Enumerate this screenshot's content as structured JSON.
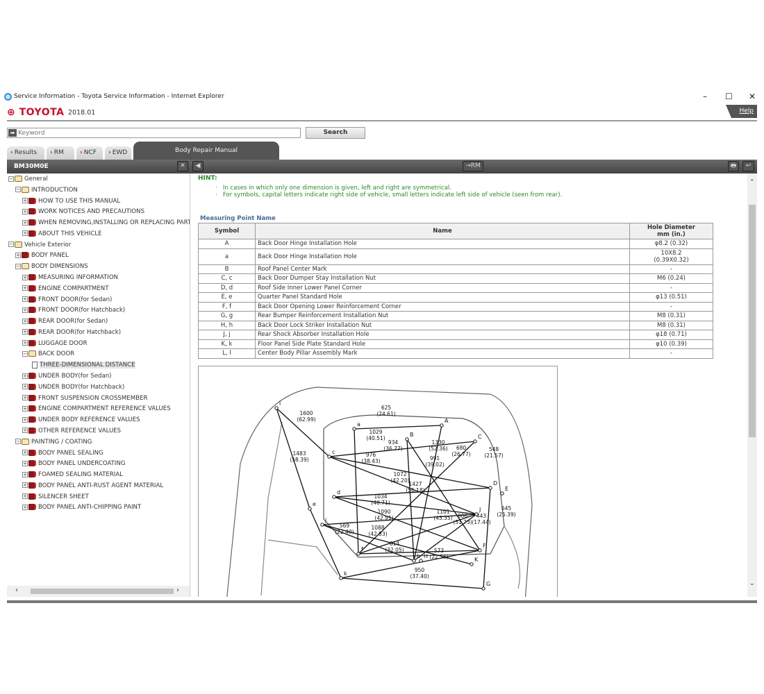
{
  "window": {
    "title": "Service Information - Toyota Service Information - Internet Explorer",
    "minimize": "–",
    "maximize": "☐",
    "close": "✕"
  },
  "header": {
    "brand": "TOYOTA",
    "version": "2018.01",
    "help": "Help"
  },
  "search": {
    "placeholder": "Keyword",
    "button": "Search"
  },
  "tabs": [
    {
      "label": "Results"
    },
    {
      "label": "RM"
    },
    {
      "label": "NCF"
    },
    {
      "label": "EWD"
    },
    {
      "label": "Body Repair Manual",
      "active": true
    }
  ],
  "left_panel": {
    "title": "BM30M0E",
    "close": "✕"
  },
  "toolbar": {
    "back": "◀",
    "to_rm": "→RM",
    "print": "🖶",
    "return": "↩"
  },
  "tree": [
    {
      "label": "General",
      "level": 0,
      "icon": "book-open",
      "expanded": true
    },
    {
      "label": "INTRODUCTION",
      "level": 1,
      "icon": "book-open",
      "expanded": true
    },
    {
      "label": "HOW TO USE THIS MANUAL",
      "level": 2,
      "icon": "book-closed"
    },
    {
      "label": "WORK NOTICES AND PRECAUTIONS",
      "level": 2,
      "icon": "book-closed"
    },
    {
      "label": "WHEN REMOVING,INSTALLING OR REPLACING PARTS",
      "level": 2,
      "icon": "book-closed"
    },
    {
      "label": "ABOUT THIS VEHICLE",
      "level": 2,
      "icon": "book-closed"
    },
    {
      "label": "Vehicle Exterior",
      "level": 0,
      "icon": "book-open",
      "expanded": true
    },
    {
      "label": "BODY PANEL",
      "level": 1,
      "icon": "book-closed"
    },
    {
      "label": "BODY DIMENSIONS",
      "level": 1,
      "icon": "book-open",
      "expanded": true
    },
    {
      "label": "MEASURING INFORMATION",
      "level": 2,
      "icon": "book-closed"
    },
    {
      "label": "ENGINE COMPARTMENT",
      "level": 2,
      "icon": "book-closed"
    },
    {
      "label": "FRONT DOOR(for Sedan)",
      "level": 2,
      "icon": "book-closed"
    },
    {
      "label": "FRONT DOOR(for Hatchback)",
      "level": 2,
      "icon": "book-closed"
    },
    {
      "label": "REAR DOOR(for Sedan)",
      "level": 2,
      "icon": "book-closed"
    },
    {
      "label": "REAR DOOR(for Hatchback)",
      "level": 2,
      "icon": "book-closed"
    },
    {
      "label": "LUGGAGE DOOR",
      "level": 2,
      "icon": "book-closed"
    },
    {
      "label": "BACK DOOR",
      "level": 2,
      "icon": "book-open",
      "expanded": true
    },
    {
      "label": "THREE-DIMENSIONAL DISTANCE",
      "level": 3,
      "icon": "page",
      "selected": true
    },
    {
      "label": "UNDER BODY(for Sedan)",
      "level": 2,
      "icon": "book-closed"
    },
    {
      "label": "UNDER BODY(for Hatchback)",
      "level": 2,
      "icon": "book-closed"
    },
    {
      "label": "FRONT SUSPENSION CROSSMEMBER",
      "level": 2,
      "icon": "book-closed"
    },
    {
      "label": "ENGINE COMPARTMENT REFERENCE VALUES",
      "level": 2,
      "icon": "book-closed"
    },
    {
      "label": "UNDER BODY REFERENCE VALUES",
      "level": 2,
      "icon": "book-closed"
    },
    {
      "label": "OTHER REFERENCE VALUES",
      "level": 2,
      "icon": "book-closed"
    },
    {
      "label": "PAINTING / COATING",
      "level": 1,
      "icon": "book-open",
      "expanded": true
    },
    {
      "label": "BODY PANEL SEALING",
      "level": 2,
      "icon": "book-closed"
    },
    {
      "label": "BODY PANEL UNDERCOATING",
      "level": 2,
      "icon": "book-closed"
    },
    {
      "label": "FOAMED SEALING MATERIAL",
      "level": 2,
      "icon": "book-closed"
    },
    {
      "label": "BODY PANEL ANTI-RUST AGENT MATERIAL",
      "level": 2,
      "icon": "book-closed"
    },
    {
      "label": "SILENCER SHEET",
      "level": 2,
      "icon": "book-closed"
    },
    {
      "label": "BODY PANEL ANTI-CHIPPING PAINT",
      "level": 2,
      "icon": "book-closed"
    }
  ],
  "content": {
    "hint_title": "HINT:",
    "hints": [
      "In cases in which only one dimension is given, left and right are symmetrical.",
      "For symbols, capital letters indicate right side of vehicle, small letters indicate left side of vehicle (seen from rear)."
    ],
    "table_title": "Measuring Point Name",
    "columns": [
      "Symbol",
      "Name",
      "Hole Diameter\nmm (in.)"
    ],
    "rows": [
      [
        "A",
        "Back Door Hinge Installation Hole",
        "φ8.2 (0.32)"
      ],
      [
        "a",
        "Back Door Hinge Installation Hole",
        "10X8.2\n(0.39X0.32)"
      ],
      [
        "B",
        "Roof Panel Center Mark",
        "-"
      ],
      [
        "C, c",
        "Back Door Dumper Stay Installation Nut",
        "M6 (0.24)"
      ],
      [
        "D, d",
        "Roof Side Inner Lower Panel Corner",
        "-"
      ],
      [
        "E, e",
        "Quarter Panel Standard Hole",
        "φ13 (0.51)"
      ],
      [
        "F, f",
        "Back Door Opening Lower Reinforcement Corner",
        "-"
      ],
      [
        "G, g",
        "Rear Bumper Reinforcement Installation Nut",
        "M8 (0.31)"
      ],
      [
        "H, h",
        "Back Door Lock Striker Installation Nut",
        "M8 (0.31)"
      ],
      [
        "J, j",
        "Rear Shock Absorber Installation Hole",
        "φ18 (0.71)"
      ],
      [
        "K, k",
        "Floor Panel Side Plate Standard Hole",
        "φ10 (0.39)"
      ],
      [
        "L, l",
        "Center Body Pillar Assembly Mark",
        "-"
      ]
    ],
    "diagram": {
      "points": [
        "l",
        "a",
        "A",
        "B",
        "C",
        "c",
        "D",
        "d",
        "E",
        "e",
        "j",
        "J",
        "F",
        "f",
        "h",
        "H",
        "K",
        "k",
        "G"
      ],
      "dimensions": [
        "1600\n(62.99)",
        "625\n(24.61)",
        "1029\n(40.51)",
        "934\n(36.77)",
        "1330\n(52.36)",
        "680\n(26.77)",
        "548\n(21.57)",
        "1483\n(58.39)",
        "976\n(38.43)",
        "991\n(39.02)",
        "1072\n(42.20)",
        "1427\n(56.18)",
        "1034\n(40.71)",
        "1090\n(42.91)",
        "1101\n(43.35)",
        "806\n(31.73)",
        "443\n(17.44)",
        "645\n(25.39)",
        "569\n(22.40)",
        "1088\n(42.83)",
        "814\n(32.05)",
        "573\n(22.56)",
        "950\n(37.40)"
      ]
    }
  }
}
